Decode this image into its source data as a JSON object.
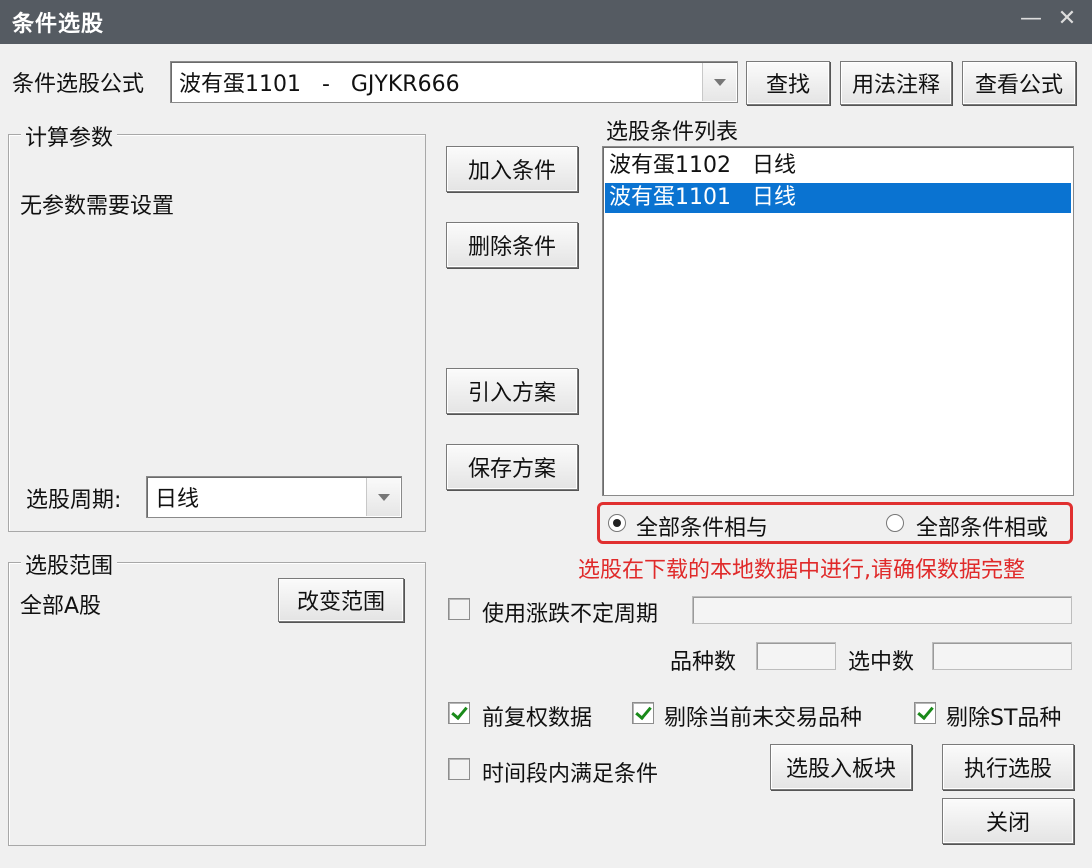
{
  "window": {
    "title": "条件选股",
    "minimize_glyph": "—",
    "close_glyph": "✕"
  },
  "formula": {
    "label": "条件选股公式",
    "selected": "波有蛋1101   -   GJYKR666",
    "find_button": "查找",
    "usage_button": "用法注释",
    "view_button": "查看公式"
  },
  "params": {
    "group_title": "计算参数",
    "text": "无参数需要设置",
    "period_label": "选股周期:",
    "period_value": "日线"
  },
  "buttons": {
    "add": "加入条件",
    "delete": "删除条件",
    "import": "引入方案",
    "save": "保存方案",
    "change_range": "改变范围",
    "to_block": "选股入板块",
    "execute": "执行选股",
    "close": "关闭"
  },
  "conditions": {
    "title": "选股条件列表",
    "items": [
      {
        "text": "波有蛋1102   日线",
        "selected": false
      },
      {
        "text": "波有蛋1101   日线",
        "selected": true
      }
    ]
  },
  "logic": {
    "and_label": "全部条件相与",
    "or_label": "全部条件相或",
    "selected": "and"
  },
  "notice": "选股在下载的本地数据中进行,请确保数据完整",
  "range": {
    "group_title": "选股范围",
    "value": "全部A股"
  },
  "options": {
    "variable_period": {
      "label": "使用涨跌不定周期",
      "checked": false
    },
    "forward_adjust": {
      "label": "前复权数据",
      "checked": true
    },
    "exclude_untraded": {
      "label": "剔除当前未交易品种",
      "checked": true
    },
    "exclude_st": {
      "label": "剔除ST品种",
      "checked": true
    },
    "time_range": {
      "label": "时间段内满足条件",
      "checked": false
    }
  },
  "stats": {
    "count_label": "品种数",
    "selected_label": "选中数"
  },
  "colors": {
    "titlebar": "#555b62",
    "selection": "#0a73d1",
    "highlight_red": "#e03030",
    "check_green": "#1a8a1a"
  }
}
